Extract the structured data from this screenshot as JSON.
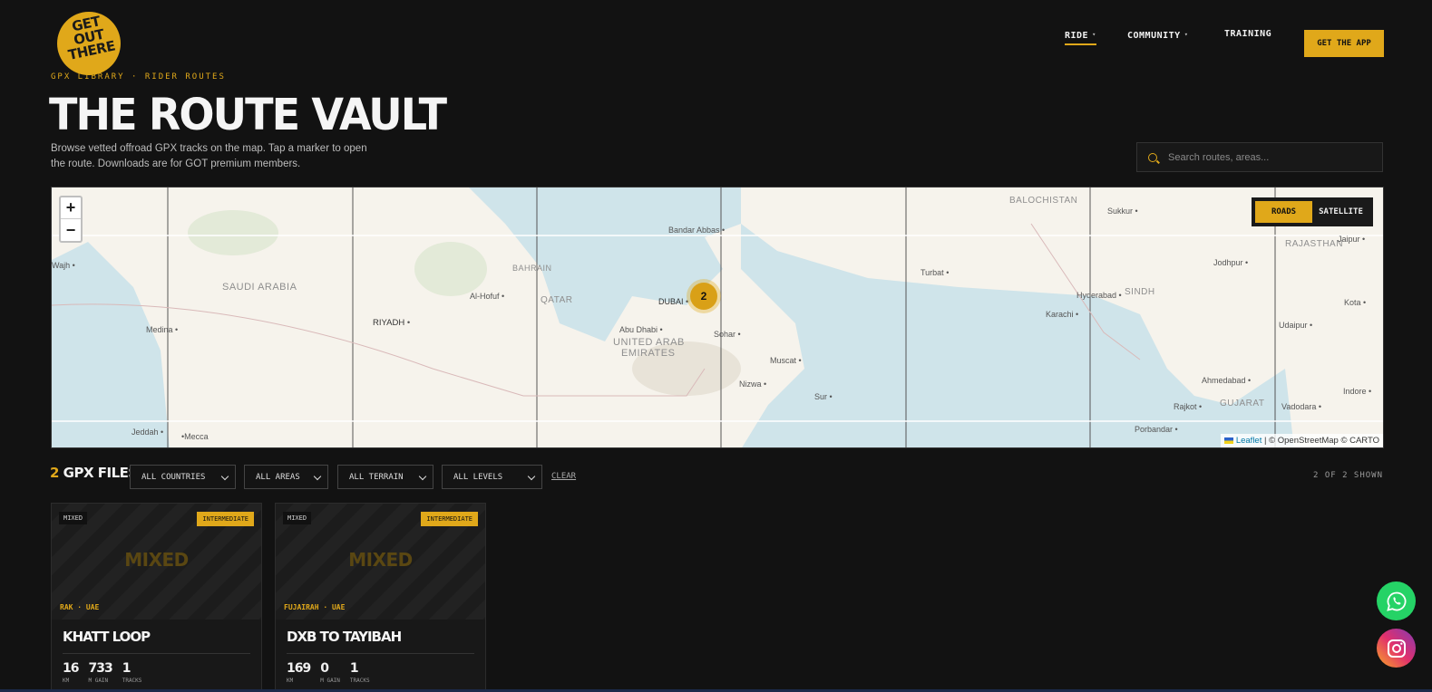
{
  "brand": {
    "logo_text": "GET OUT THERE"
  },
  "nav": {
    "items": [
      {
        "label": "RIDE",
        "dropdown": true,
        "active": true
      },
      {
        "label": "COMMUNITY",
        "dropdown": true,
        "active": false
      },
      {
        "label": "TRAINING",
        "dropdown": false,
        "active": false
      }
    ],
    "cta_label": "GET THE APP"
  },
  "hero": {
    "eyebrow": "GPX LIBRARY · RIDER ROUTES",
    "title": "THE ROUTE VAULT",
    "subtitle": "Browse vetted offroad GPX tracks on the map. Tap a marker to open the route. Downloads are for GOT premium members."
  },
  "search": {
    "placeholder": "Search routes, areas..."
  },
  "map": {
    "zoom_in": "+",
    "zoom_out": "−",
    "layer_roads": "ROADS",
    "layer_satellite": "SATELLITE",
    "active_layer": "ROADS",
    "cluster_count": "2",
    "attribution_leaflet": "Leaflet",
    "attribution_rest": " | © OpenStreetMap © CARTO",
    "regions": [
      "SAUDI ARABIA",
      "UNITED ARAB",
      "EMIRATES",
      "QATAR",
      "BAHRAIN",
      "BALOCHISTAN",
      "SINDH",
      "RAJASTHAN",
      "GUJARAT"
    ],
    "cities": [
      "Medina",
      "Wajh",
      "RIYADH",
      "Al-Hofuf",
      "DUBAI",
      "Abu Dhabi",
      "Bandar Abbas",
      "Sohar",
      "Muscat",
      "Nizwa",
      "Sur",
      "Turbat",
      "Karachi",
      "Hyderabad",
      "Sukkur",
      "Jodhpur",
      "Jaipur",
      "Kota",
      "Udaipur",
      "Ahmedabad",
      "Rajkot",
      "Vadodara",
      "Indore",
      "Porbandar",
      "Jeddah",
      "Mecca"
    ]
  },
  "filters": {
    "count": "2",
    "count_label": "GPX FILES",
    "countries": "ALL COUNTRIES",
    "areas": "ALL AREAS",
    "terrain": "ALL TERRAIN",
    "levels": "ALL LEVELS",
    "clear": "CLEAR",
    "shown": "2 OF 2 SHOWN"
  },
  "routes": [
    {
      "tag": "MIXED",
      "level": "INTERMEDIATE",
      "terrain": "MIXED",
      "location": "RAK · UAE",
      "title": "KHATT LOOP",
      "km": "16",
      "gain": "733",
      "tracks": "1"
    },
    {
      "tag": "MIXED",
      "level": "INTERMEDIATE",
      "terrain": "MIXED",
      "location": "FUJAIRAH · UAE",
      "title": "DXB TO TAYIBAH",
      "km": "169",
      "gain": "0",
      "tracks": "1"
    }
  ],
  "stat_labels": {
    "km": "KM",
    "gain": "M GAIN",
    "tracks": "TRACKS"
  },
  "colors": {
    "accent": "#e0a81a",
    "background": "#121212",
    "whatsapp": "#25d366"
  },
  "social": {
    "whatsapp_icon": "whatsapp-icon",
    "instagram_icon": "instagram-icon"
  }
}
